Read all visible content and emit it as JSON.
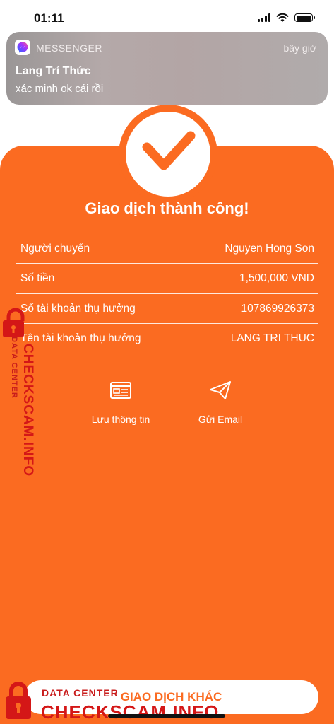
{
  "status_bar": {
    "time": "01:11"
  },
  "notification": {
    "app_name": "MESSENGER",
    "time": "bây giờ",
    "sender": "Lang Trí Thức",
    "message": "xác minh ok  cái rồi"
  },
  "receipt": {
    "title": "Giao dịch thành công!",
    "rows": [
      {
        "label": "Người chuyển",
        "value": "Nguyen Hong Son"
      },
      {
        "label": "Số tiền",
        "value": "1,500,000 VND"
      },
      {
        "label": "Số tài khoản thụ hưởng",
        "value": "107869926373"
      },
      {
        "label": "Tên tài khoản thụ hưởng",
        "value": "LANG TRI THUC"
      }
    ],
    "actions": {
      "save_label": "Lưu thông tin",
      "email_label": "Gửi Email"
    },
    "other_transaction_label": "GIAO DỊCH KHÁC"
  },
  "watermark": {
    "line1": "DATA CENTER",
    "line2": "CHECKSCAM.INFO"
  },
  "colors": {
    "accent": "#fb6b21",
    "watermark": "#d41717"
  }
}
